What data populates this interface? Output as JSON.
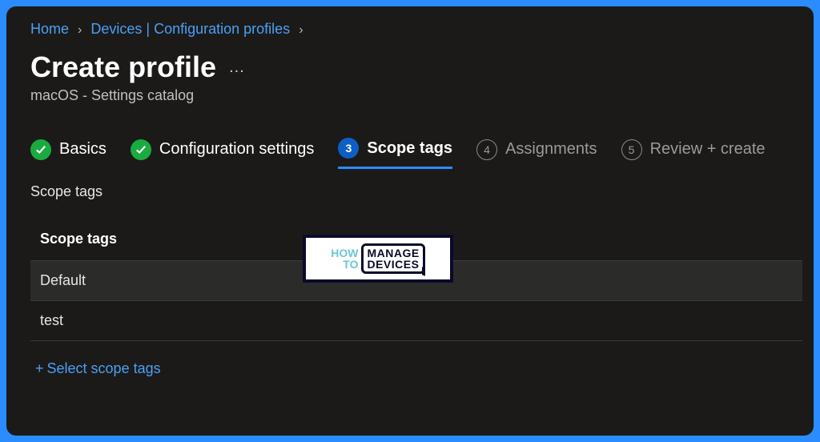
{
  "breadcrumb": {
    "items": [
      "Home",
      "Devices | Configuration profiles"
    ]
  },
  "page": {
    "title": "Create profile",
    "subtitle": "macOS - Settings catalog",
    "more": "..."
  },
  "wizard": {
    "steps": [
      {
        "num": "1",
        "label": "Basics",
        "state": "done"
      },
      {
        "num": "2",
        "label": "Configuration settings",
        "state": "done"
      },
      {
        "num": "3",
        "label": "Scope tags",
        "state": "active"
      },
      {
        "num": "4",
        "label": "Assignments",
        "state": "future"
      },
      {
        "num": "5",
        "label": "Review + create",
        "state": "future"
      }
    ]
  },
  "section": {
    "label": "Scope tags"
  },
  "table": {
    "header": "Scope tags",
    "rows": [
      "Default",
      "test"
    ]
  },
  "actions": {
    "select_scope_tags": "Select scope tags",
    "plus": "+"
  },
  "watermark": {
    "left_top": "HOW",
    "left_bottom": "TO",
    "box_top": "MANAGE",
    "box_bottom": "DEVICES"
  }
}
